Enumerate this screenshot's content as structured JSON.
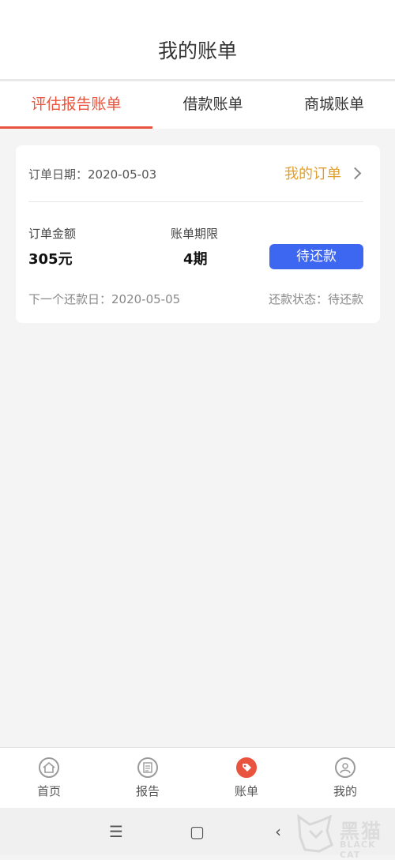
{
  "header": {
    "title": "我的账单"
  },
  "tabs": [
    {
      "label": "评估报告账单",
      "active": true
    },
    {
      "label": "借款账单",
      "active": false
    },
    {
      "label": "商城账单",
      "active": false
    }
  ],
  "order": {
    "date_text": "订单日期：2020-05-03",
    "my_order_label": "我的订单",
    "amount_label": "订单金额",
    "amount_value": "305元",
    "term_label": "账单期限",
    "term_value": "4期",
    "pay_button": "待还款",
    "next_repay_text": "下一个还款日：2020-05-05",
    "status_text": "还款状态：待还款"
  },
  "bottom_nav": [
    {
      "label": "首页",
      "icon": "home-icon"
    },
    {
      "label": "报告",
      "icon": "report-icon"
    },
    {
      "label": "账单",
      "icon": "bill-tag-icon",
      "active": true
    },
    {
      "label": "我的",
      "icon": "user-icon"
    }
  ],
  "system_nav": {
    "menu": "☰",
    "home": "▢",
    "back": "‹"
  },
  "watermark": {
    "cn": "黑猫",
    "en": "BLACK CAT"
  },
  "colors": {
    "accent": "#e8543d",
    "button": "#3e67f1",
    "order_link": "#e0a030"
  }
}
